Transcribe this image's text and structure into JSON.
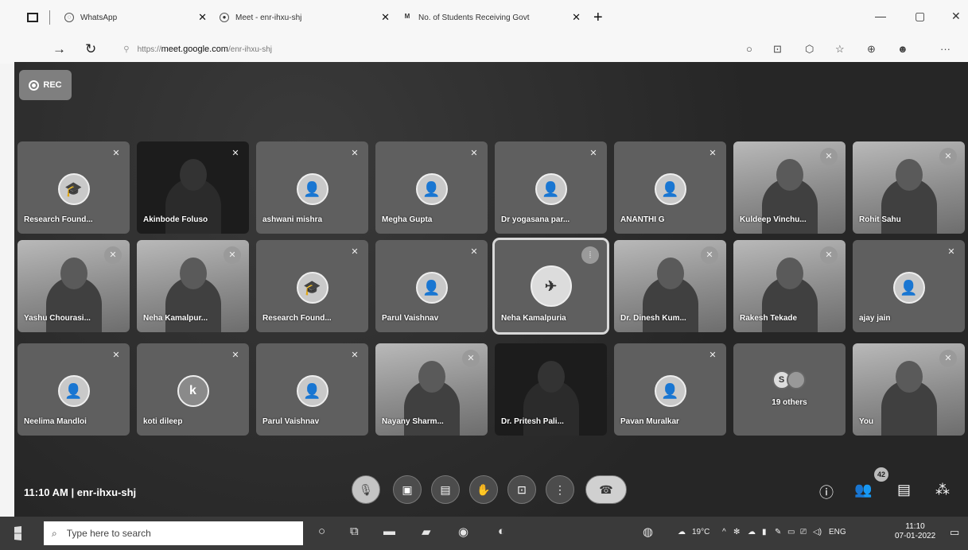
{
  "browser": {
    "tabs": [
      {
        "label": "WhatsApp",
        "icon": "whatsapp-icon"
      },
      {
        "label": "Meet - enr-ihxu-shj",
        "icon": "meet-icon"
      },
      {
        "label": "No. of Students Receiving Govt",
        "icon": "gmail-icon"
      }
    ],
    "url_prefix": "https://",
    "url_host": "meet.google.com",
    "url_path": "/enr-ihxu-shj"
  },
  "meet": {
    "rec_label": "REC",
    "time": "11:10 AM",
    "meeting_code": "enr-ihxu-shj",
    "people_count": "42",
    "participants": [
      {
        "name": "Research Found...",
        "kind": "avatar",
        "glyph": "🎓",
        "mic": "muted"
      },
      {
        "name": "Akinbode Foluso",
        "kind": "dark",
        "mic": "muted"
      },
      {
        "name": "ashwani mishra",
        "kind": "avatar",
        "glyph": "👤",
        "mic": "muted"
      },
      {
        "name": "Megha Gupta",
        "kind": "avatar",
        "glyph": "👤",
        "mic": "muted"
      },
      {
        "name": "Dr yogasana par...",
        "kind": "avatar",
        "glyph": "👤",
        "mic": "muted"
      },
      {
        "name": "ANANTHI G",
        "kind": "avatar",
        "glyph": "👤",
        "mic": "muted"
      },
      {
        "name": "Kuldeep Vinchu...",
        "kind": "cam",
        "mic": "muted"
      },
      {
        "name": "Rohit Sahu",
        "kind": "cam",
        "mic": "muted"
      },
      {
        "name": "Yashu Chourasi...",
        "kind": "cam",
        "mic": "muted"
      },
      {
        "name": "Neha Kamalpur...",
        "kind": "cam",
        "mic": "muted"
      },
      {
        "name": "Research Found...",
        "kind": "avatar",
        "glyph": "🎓",
        "mic": "muted"
      },
      {
        "name": "Parul Vaishnav",
        "kind": "avatar",
        "glyph": "👤",
        "mic": "muted"
      },
      {
        "name": "Neha Kamalpuria",
        "kind": "avatar-big",
        "glyph": "✈",
        "mic": "speaking"
      },
      {
        "name": "Dr. Dinesh Kum...",
        "kind": "cam",
        "mic": "muted"
      },
      {
        "name": "Rakesh Tekade",
        "kind": "cam",
        "mic": "muted"
      },
      {
        "name": "ajay jain",
        "kind": "avatar",
        "glyph": "👤",
        "mic": "muted"
      },
      {
        "name": "Neelima Mandloi",
        "kind": "avatar",
        "glyph": "👤",
        "mic": "muted"
      },
      {
        "name": "koti dileep",
        "kind": "letter",
        "glyph": "k",
        "mic": "muted"
      },
      {
        "name": "Parul Vaishnav",
        "kind": "avatar",
        "glyph": "👤",
        "mic": "muted"
      },
      {
        "name": "Nayany Sharm...",
        "kind": "cam",
        "mic": "muted"
      },
      {
        "name": "Dr. Pritesh Pali...",
        "kind": "dark",
        "mic": "none"
      },
      {
        "name": "Pavan Muralkar",
        "kind": "avatar",
        "glyph": "👤",
        "mic": "muted"
      },
      {
        "name": "19 others",
        "kind": "others",
        "glyph": "S",
        "mic": "none"
      },
      {
        "name": "You",
        "kind": "cam",
        "mic": "muted"
      }
    ]
  },
  "taskbar": {
    "search_placeholder": "Type here to search",
    "weather": "19°C",
    "language": "ENG",
    "clock_time": "11:10",
    "clock_date": "07-01-2022"
  }
}
